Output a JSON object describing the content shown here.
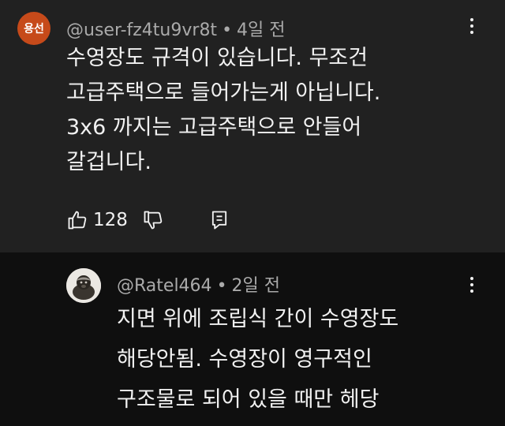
{
  "top_comment": {
    "avatar_initials": "용선",
    "handle": "@user-fz4tu9vr8t",
    "separator": "•",
    "time": "4일 전",
    "lines": [
      "수영장도 규격이 있습니다. 무조건",
      "고급주택으로 들어가는게 아닙니다.",
      "3x6 까지는 고급주택으로 안들어",
      "갈겁니다."
    ],
    "like_count": "128",
    "icons": [
      "like-icon",
      "dislike-icon",
      "reply-icon",
      "more-icon"
    ]
  },
  "reply": {
    "handle": "@Ratel464",
    "separator": "•",
    "time": "2일 전",
    "lines": [
      "지면 위에 조립식 간이 수영장도",
      "해당안됨. 수영장이 영구적인",
      "구조물로 되어 있을 때만 헤당"
    ],
    "icons": [
      "more-icon"
    ]
  },
  "colors": {
    "top_background": "#212121",
    "reply_background": "#0f0f0f",
    "avatar_background": "#c64a1a",
    "primary_text": "#f1f1f1",
    "secondary_text": "#aaaaaa"
  }
}
